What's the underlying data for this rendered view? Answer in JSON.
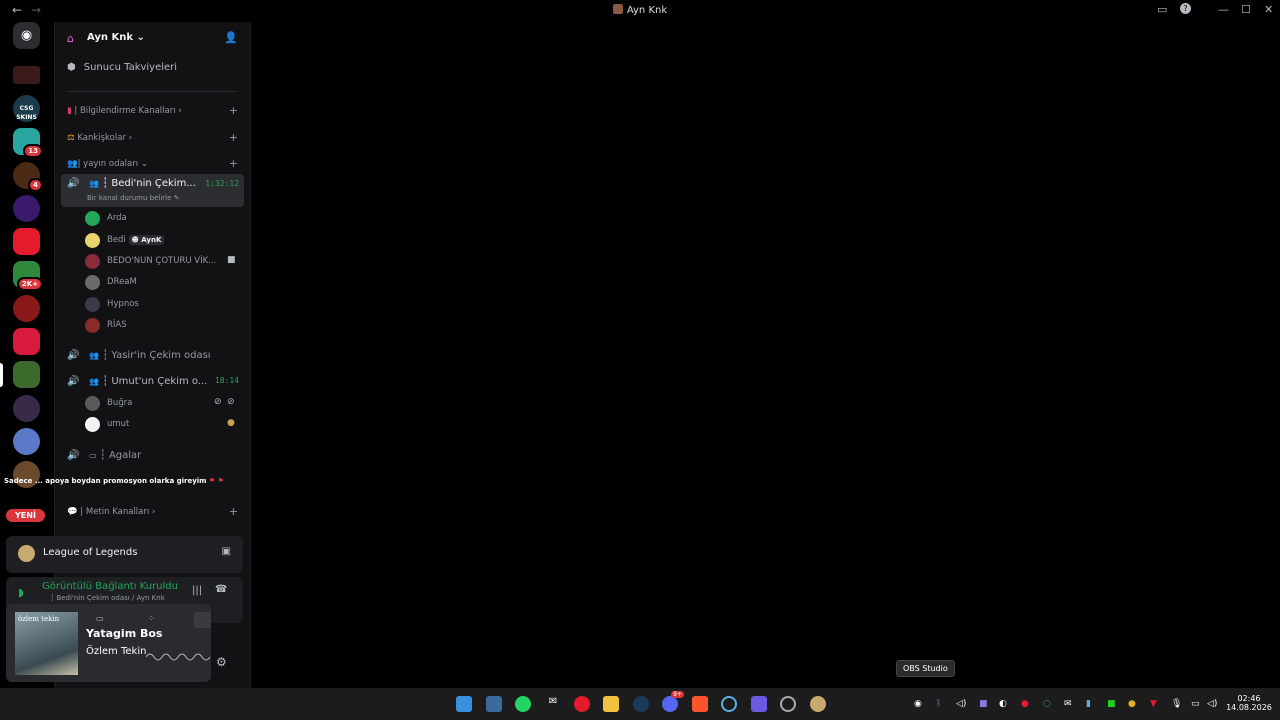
{
  "window": {
    "title": "Ayn Knk"
  },
  "server": {
    "name": "Ayn Knk",
    "boosts_label": "Sunucu Takviyeleri"
  },
  "categories": {
    "info": "| Bilgilendirme Kanalları",
    "kankiskolar": "Kankişkolar",
    "yayin": "| yayın odaları",
    "metin": "| Metin Kanalları"
  },
  "channels": {
    "bedi": {
      "name": "┆ Bedi'nin Çekim...",
      "timer": "1:32:12",
      "status": "Bir kanal durumu belirle"
    },
    "yasir": {
      "name": "┆ Yasir'in Çekim odası"
    },
    "umut": {
      "name": "┆ Umut'un Çekim o...",
      "timer": "18:14"
    },
    "agalar": {
      "name": "┆ Agalar"
    }
  },
  "users_bedi": [
    {
      "name": "Arda"
    },
    {
      "name": "Bedi",
      "tag": "AynK"
    },
    {
      "name": "BEDO'NUN ÇOTURU VİK..."
    },
    {
      "name": "DReaM"
    },
    {
      "name": "Hypnos"
    },
    {
      "name": "RİAS"
    }
  ],
  "users_umut": [
    {
      "name": "Buğra"
    },
    {
      "name": "umut"
    }
  ],
  "guild_badges": {
    "g1": "13",
    "g2": "4",
    "g3": "2K+"
  },
  "new_label": "YENİ",
  "promo_text": "Sadece ... apoya boydan promosyon olarka gireyim",
  "activity": {
    "game": "League of Legends"
  },
  "connection": {
    "status": "Görüntülü Bağlantı Kuruldu",
    "channel": "┆ Bedi'nin Çekim odası / Ayn Knk"
  },
  "music": {
    "title": "Yatagim Bos",
    "artist": "Özlem Tekin",
    "cover_text": "özlem tekin"
  },
  "tooltip": "OBS Studio",
  "clock": {
    "time": "02:46",
    "date": "14.08.2026"
  },
  "discord_badge": "9+"
}
